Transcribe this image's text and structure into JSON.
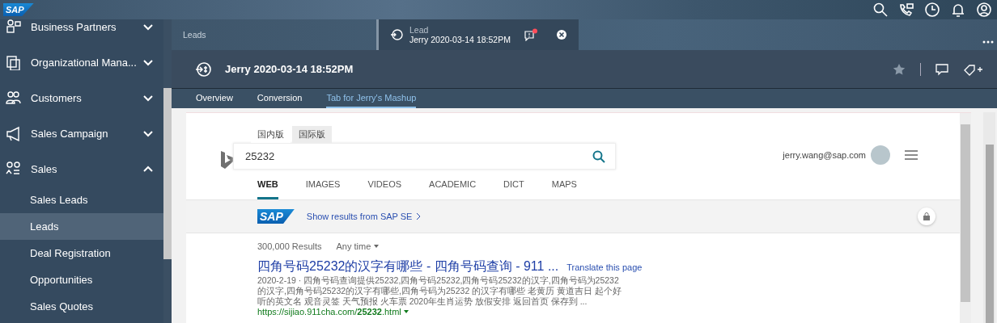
{
  "shell_bar": {
    "logo": "SAP"
  },
  "sidebar": {
    "items": [
      {
        "label": "Business Partners",
        "expanded": false
      },
      {
        "label": "Organizational Mana...",
        "expanded": false
      },
      {
        "label": "Customers",
        "expanded": false
      },
      {
        "label": "Sales Campaign",
        "expanded": false
      },
      {
        "label": "Sales",
        "expanded": true,
        "children": [
          {
            "label": "Sales Leads",
            "selected": false
          },
          {
            "label": "Leads",
            "selected": true
          },
          {
            "label": "Deal Registration",
            "selected": false
          },
          {
            "label": "Opportunities",
            "selected": false
          },
          {
            "label": "Sales Quotes",
            "selected": false
          }
        ]
      }
    ]
  },
  "open_tabs": [
    {
      "label": "Leads",
      "selected": false
    },
    {
      "caption": "Lead",
      "label": "Jerry 2020-03-14 18:52PM",
      "selected": true,
      "notification": true
    }
  ],
  "record": {
    "title": "Jerry 2020-03-14 18:52PM",
    "tabs": [
      {
        "label": "Overview",
        "selected": false
      },
      {
        "label": "Conversion",
        "selected": false
      },
      {
        "label": "Tab for Jerry's Mashup",
        "selected": true
      }
    ]
  },
  "bing": {
    "scopes": [
      {
        "label": "国内版",
        "selected": true
      },
      {
        "label": "国际版",
        "selected": false
      }
    ],
    "query": "25232",
    "account": "jerry.wang@sap.com",
    "nav": [
      {
        "label": "WEB",
        "selected": true
      },
      {
        "label": "IMAGES",
        "selected": false
      },
      {
        "label": "VIDEOS",
        "selected": false
      },
      {
        "label": "ACADEMIC",
        "selected": false
      },
      {
        "label": "DICT",
        "selected": false
      },
      {
        "label": "MAPS",
        "selected": false
      }
    ],
    "banner": {
      "logo": "SAP",
      "link": "Show results from SAP SE"
    },
    "results_count": "300,000 Results",
    "time_filter": "Any time",
    "results": [
      {
        "title": "四角号码25232的汉字有哪些 - 四角号码查询 - 911 ...",
        "translate": "Translate this page",
        "snippet": "2020-2-19 · 四角号码查询提供25232,四角号码25232,四角号码25232的汉字,四角号码为25232的汉字,四角号码25232的汉字有哪些,四角号码为25232 的汉字有哪些 老黄历 黄道吉日 起个好听的英文名 观音灵签 天气预报 火车票 2020年生肖运势 放假安排 返回首页 保存到 ...",
        "url": "https://sijiao.911cha.com/**25232**.html"
      }
    ]
  }
}
